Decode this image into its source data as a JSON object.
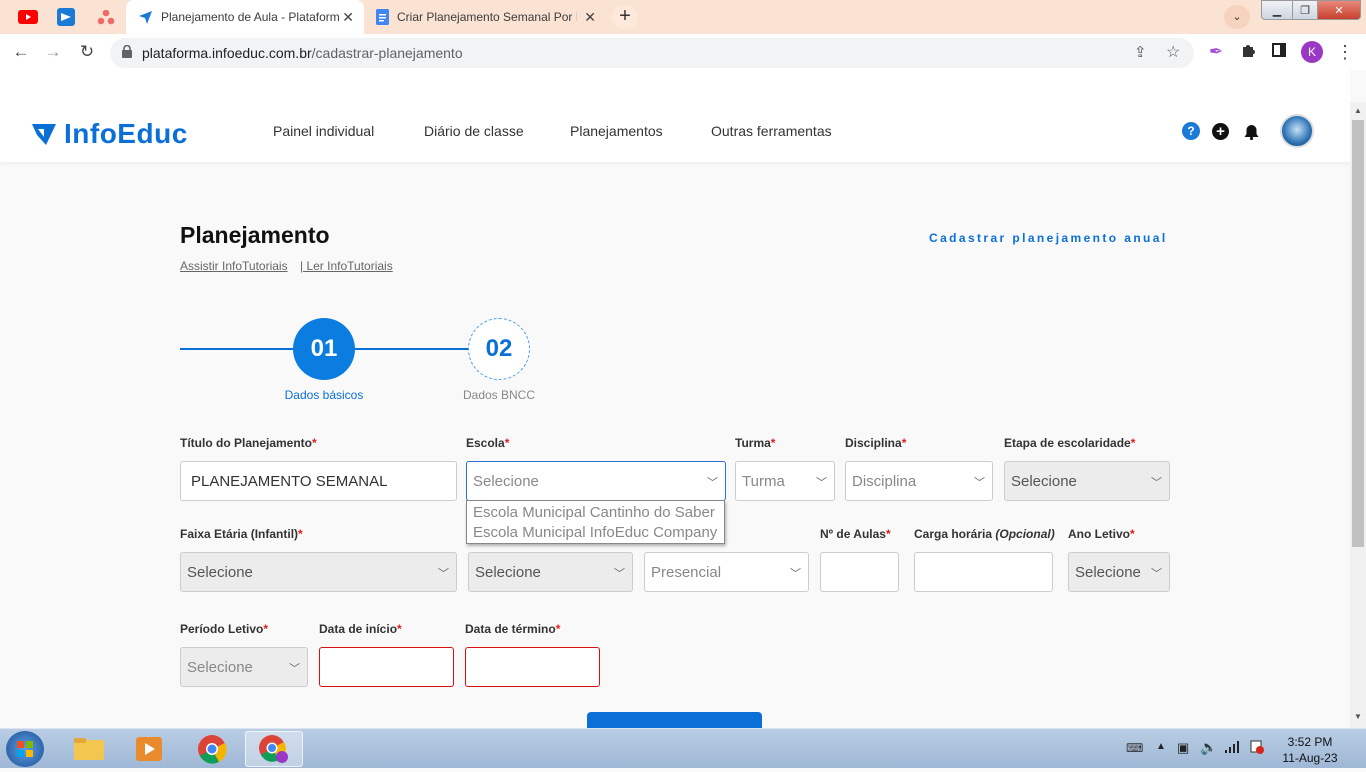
{
  "browser": {
    "tabs": [
      {
        "title": "Planejamento de Aula - Plataform",
        "active": true
      },
      {
        "title": "Criar Planejamento Semanal Por I",
        "active": false
      }
    ],
    "new_tab": "+",
    "url_domain": "plataforma.infoeduc.com.br",
    "url_path": "/cadastrar-planejamento",
    "profile_initial": "K"
  },
  "header": {
    "logo_text": "InfoEduc",
    "nav": [
      "Painel individual",
      "Diário de classe",
      "Planejamentos",
      "Outras ferramentas"
    ],
    "help_icon": "?",
    "colors": {
      "brand": "#0b6fd8"
    }
  },
  "page": {
    "title": "Planejamento",
    "link_tutoriais": "Assistir InfoTutoriais",
    "link_ler": "| Ler InfoTutoriais",
    "annual_link": "Cadastrar planejamento anual"
  },
  "steps": [
    {
      "number": "01",
      "label": "Dados básicos",
      "active": true
    },
    {
      "number": "02",
      "label": "Dados BNCC",
      "active": false
    }
  ],
  "form": {
    "required_mark": "*",
    "titulo": {
      "label": "Título do Planejamento",
      "value": "PLANEJAMENTO SEMANAL"
    },
    "escola": {
      "label": "Escola",
      "value": "Selecione",
      "options": [
        "Escola Municipal Cantinho do Saber",
        "Escola Municipal InfoEduc Company"
      ]
    },
    "turma": {
      "label": "Turma",
      "value": "Turma"
    },
    "disciplina": {
      "label": "Disciplina",
      "value": "Disciplina"
    },
    "etapa": {
      "label": "Etapa de escolaridade",
      "value": "Selecione"
    },
    "faixa": {
      "label": "Faixa Etária (Infantil)",
      "value": "Selecione"
    },
    "select_mid": {
      "value": "Selecione"
    },
    "modalidade": {
      "value": "Presencial"
    },
    "num_aulas": {
      "label": "Nº de Aulas",
      "value": ""
    },
    "carga": {
      "label": "Carga horária",
      "label_optional": "(Opcional)",
      "value": ""
    },
    "ano_letivo": {
      "label": "Ano Letivo",
      "value": "Selecione"
    },
    "periodo": {
      "label": "Período Letivo",
      "value": "Selecione"
    },
    "data_inicio": {
      "label": "Data de início",
      "value": ""
    },
    "data_termino": {
      "label": "Data de término",
      "value": ""
    }
  },
  "taskbar": {
    "time": "3:52 PM",
    "date": "11-Aug-23"
  }
}
